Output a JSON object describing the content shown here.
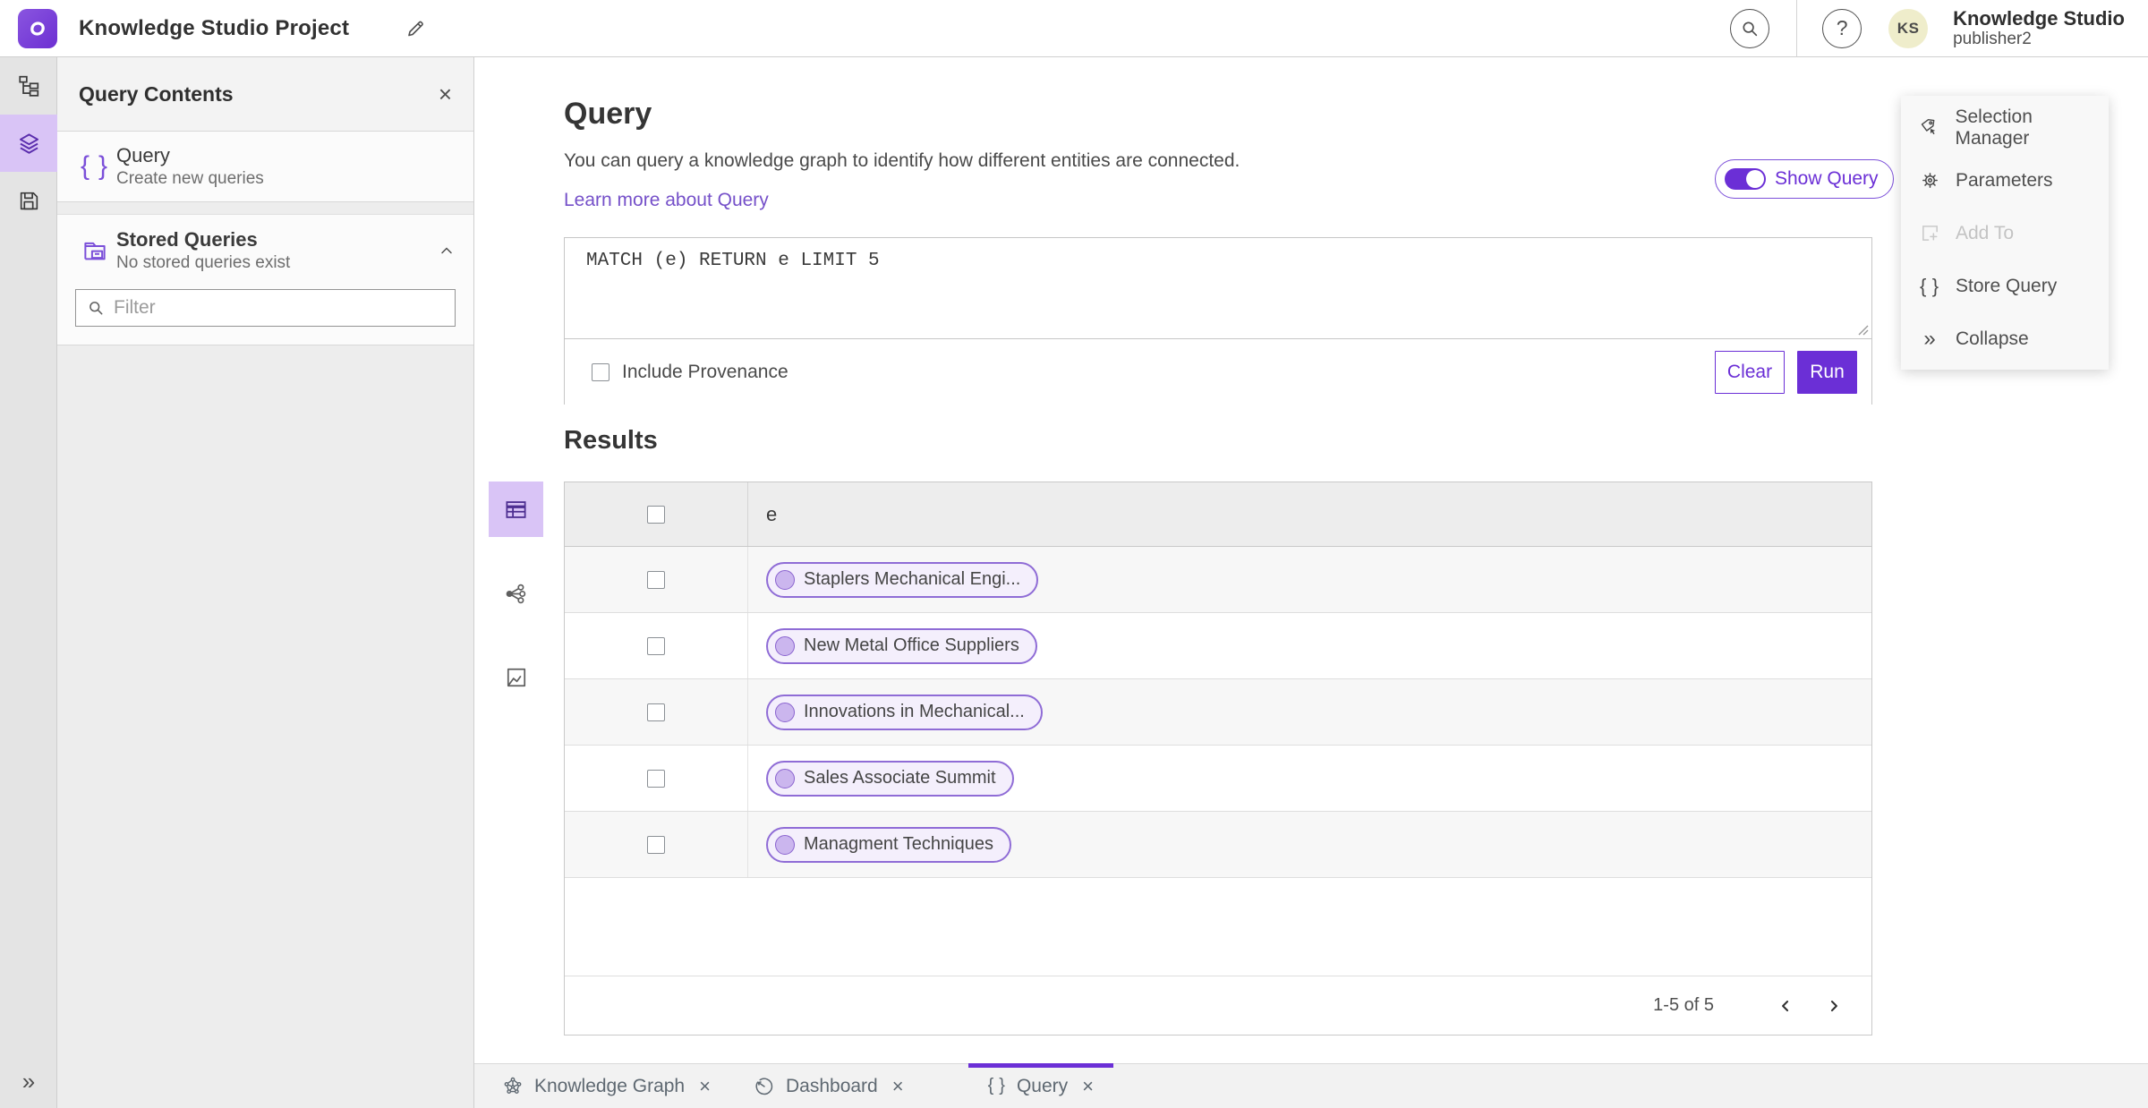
{
  "topbar": {
    "title": "Knowledge Studio Project",
    "user_initials": "KS",
    "user_name": "Knowledge Studio",
    "user_role": "publisher2"
  },
  "left_panel": {
    "title": "Query Contents",
    "query_item": {
      "title": "Query",
      "subtitle": "Create new queries"
    },
    "stored": {
      "title": "Stored Queries",
      "subtitle": "No stored queries exist"
    },
    "filter_placeholder": "Filter"
  },
  "main": {
    "title": "Query",
    "description": "You can query a knowledge graph to identify how different entities are connected.",
    "learn_more": "Learn more about Query",
    "show_query_label": "Show Query",
    "query_text": "MATCH (e) RETURN e LIMIT 5",
    "include_provenance_label": "Include Provenance",
    "clear_label": "Clear",
    "run_label": "Run",
    "results_title": "Results",
    "column_header": "e"
  },
  "results": {
    "rows": [
      {
        "label": "Staplers Mechanical Engi..."
      },
      {
        "label": "New Metal Office Suppliers"
      },
      {
        "label": "Innovations in Mechanical..."
      },
      {
        "label": "Sales Associate Summit"
      },
      {
        "label": "Managment Techniques"
      }
    ],
    "pagination": "1-5 of 5"
  },
  "actions": {
    "items": [
      {
        "label": "Selection Manager"
      },
      {
        "label": "Parameters"
      },
      {
        "label": "Add To",
        "disabled": true
      },
      {
        "label": "Store Query"
      },
      {
        "label": "Collapse"
      }
    ]
  },
  "tabs": [
    {
      "label": "Knowledge Graph"
    },
    {
      "label": "Dashboard"
    },
    {
      "label": "Query",
      "active": true
    }
  ],
  "colors": {
    "accent": "#6b2fd6",
    "accent_light": "#d9c4f6",
    "pill_border": "#8f6cd6",
    "pill_bg": "#f4effc",
    "link": "#7550c9",
    "avatar_bg": "#efedcb"
  }
}
